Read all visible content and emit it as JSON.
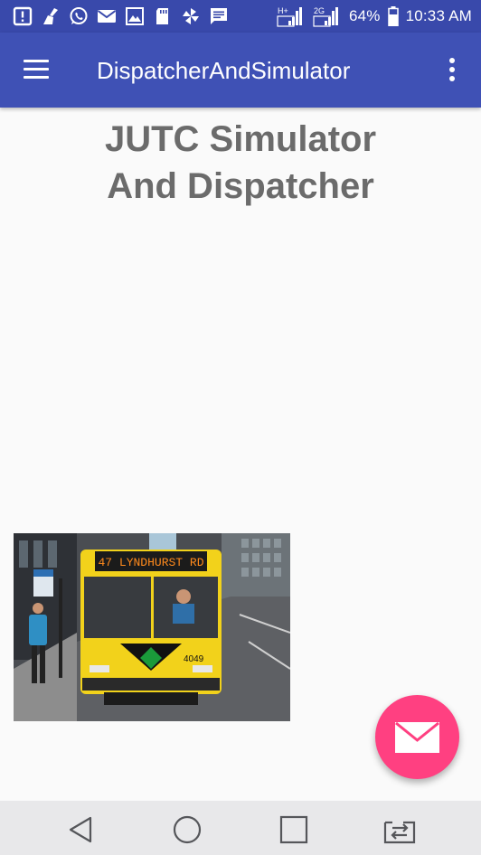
{
  "status_bar": {
    "left_icons": [
      "alert-icon",
      "broom-icon",
      "whatsapp-icon",
      "email-icon",
      "image-icon",
      "sd-card-icon",
      "pinwheel-icon",
      "message-icon"
    ],
    "network_type_1": "H+",
    "network_type_2": "2G",
    "battery": "64%",
    "time": "10:33 AM"
  },
  "app_bar": {
    "title": "DispatcherAndSimulator",
    "menu_icon": "hamburger-icon",
    "overflow_icon": "more-vert-icon",
    "color": "#3f51b5"
  },
  "main": {
    "heading": "JUTC Simulator\nAnd Dispatcher",
    "bus": {
      "destination_sign": "47 LYNDHURST RD",
      "fleet_number": "4049"
    }
  },
  "fab": {
    "icon": "envelope-icon",
    "color": "#ff4081"
  },
  "nav_bar": {
    "buttons": [
      "back-icon",
      "home-icon",
      "recents-icon",
      "dual-window-icon"
    ]
  }
}
